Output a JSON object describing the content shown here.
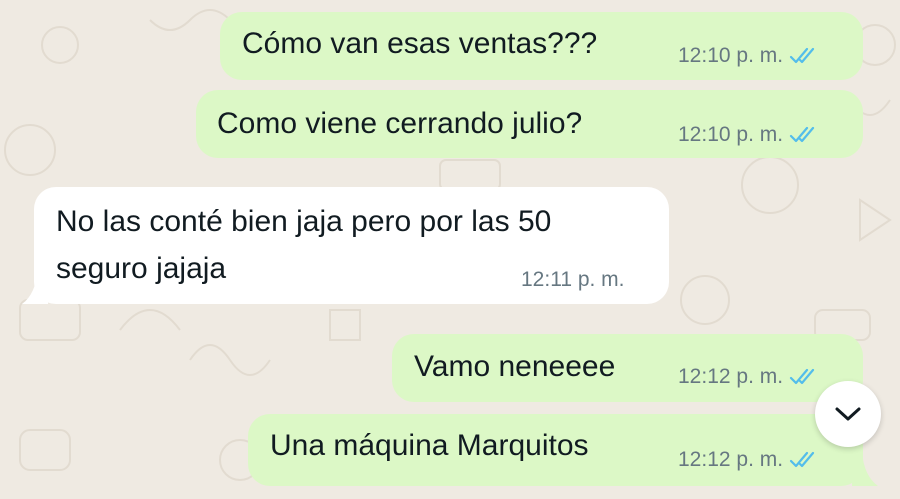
{
  "chat": {
    "messages": [
      {
        "direction": "outgoing",
        "text": "Cómo van esas ventas???",
        "time": "12:10 p. m.",
        "status": "read"
      },
      {
        "direction": "outgoing",
        "text": "Como viene cerrando julio?",
        "time": "12:10 p. m.",
        "status": "read"
      },
      {
        "direction": "incoming",
        "text_line1": "No las conté bien jaja pero por las 50",
        "text_line2": "seguro jajaja",
        "time": "12:11 p. m."
      },
      {
        "direction": "outgoing",
        "text": "Vamo neneeee",
        "time": "12:12 p. m.",
        "status": "read"
      },
      {
        "direction": "outgoing",
        "text": "Una máquina Marquitos",
        "time": "12:12 p. m.",
        "status": "read"
      }
    ]
  },
  "colors": {
    "background": "#efeae2",
    "outgoing_bubble": "#dcf8c6",
    "incoming_bubble": "#ffffff",
    "read_ticks": "#53bdeb",
    "timestamp": "#667781"
  },
  "icons": {
    "read_ticks": "double-check-icon",
    "scroll_down": "chevron-down-icon"
  }
}
